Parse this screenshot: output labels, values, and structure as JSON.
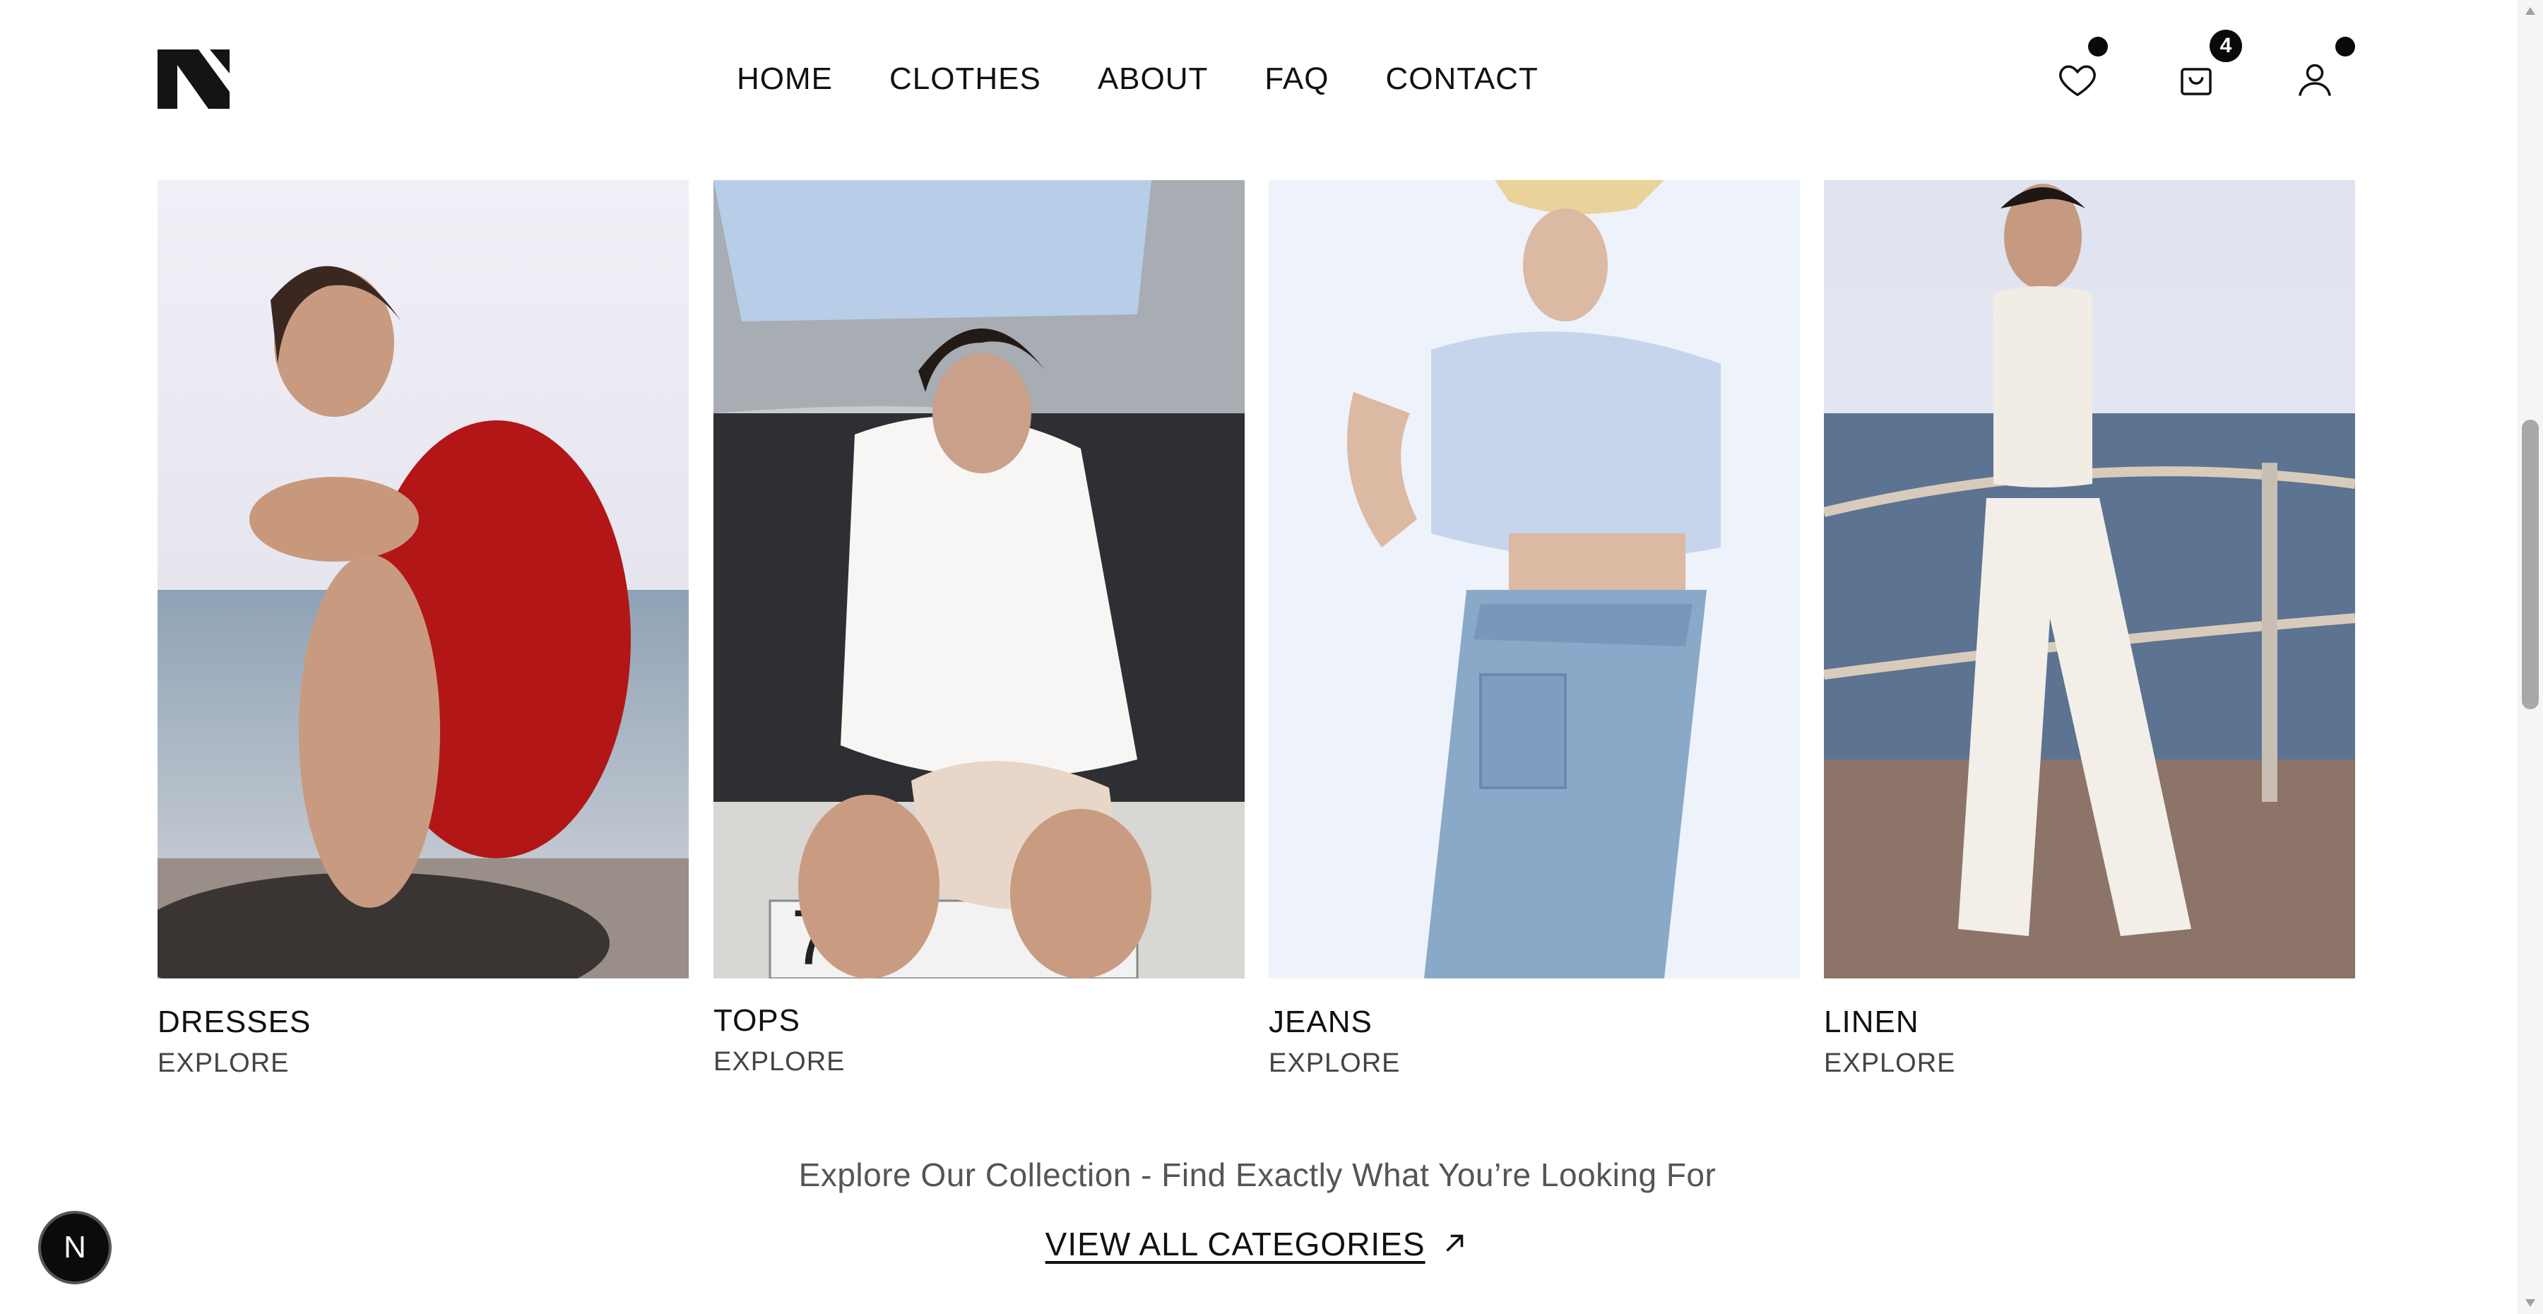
{
  "brand": {
    "logo_letter": "N"
  },
  "nav": {
    "items": [
      {
        "label": "HOME"
      },
      {
        "label": "CLOTHES"
      },
      {
        "label": "ABOUT"
      },
      {
        "label": "FAQ"
      },
      {
        "label": "CONTACT"
      }
    ]
  },
  "header_icons": {
    "wishlist": {
      "icon": "heart-icon",
      "has_dot": true
    },
    "cart": {
      "icon": "shopping-bag-icon",
      "count": "4"
    },
    "account": {
      "icon": "user-icon",
      "has_dot": true
    }
  },
  "categories": [
    {
      "title": "DRESSES",
      "cta": "EXPLORE",
      "photo": "woman crouching in red dress by the sea"
    },
    {
      "title": "TOPS",
      "cta": "EXPLORE",
      "photo": "woman in white shirt sitting on car trunk"
    },
    {
      "title": "JEANS",
      "cta": "EXPLORE",
      "photo": "woman in light blue top and jeans"
    },
    {
      "title": "LINEN",
      "cta": "EXPLORE",
      "photo": "woman in white linen outfit on seaside pier"
    }
  ],
  "footer_cta": {
    "tagline": "Explore Our Collection - Find Exactly What You’re Looking For",
    "link_label": "VIEW ALL CATEGORIES"
  },
  "floating_button": {
    "label": "N"
  },
  "colors": {
    "text": "#111111",
    "muted": "#555555",
    "accent": "#0a0a0a",
    "background": "#ffffff"
  }
}
